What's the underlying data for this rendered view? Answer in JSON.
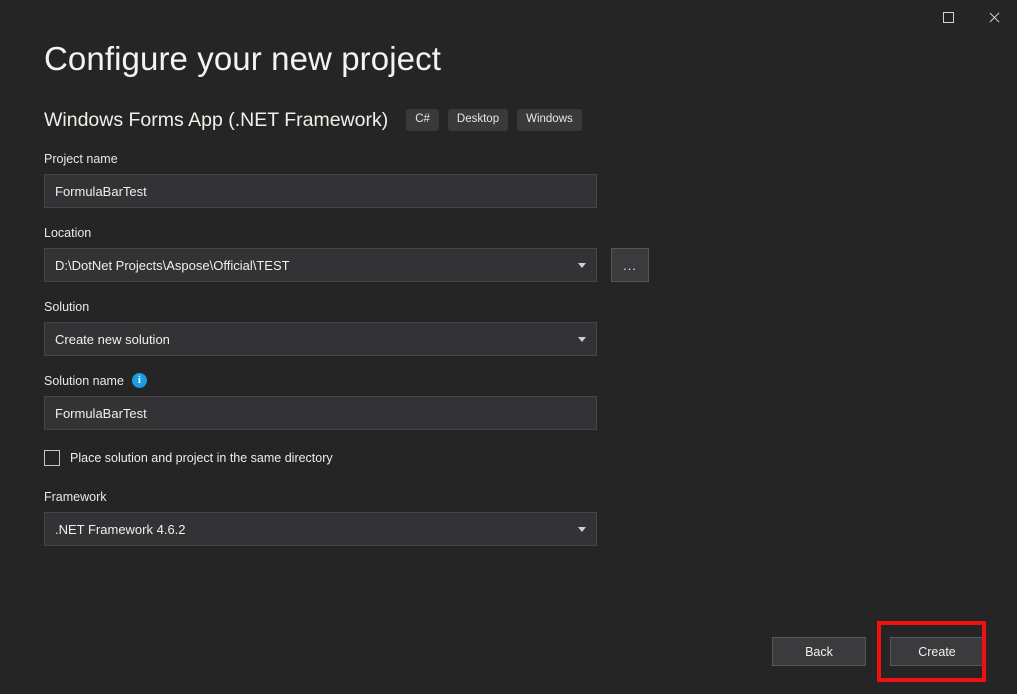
{
  "window": {
    "controls": [
      {
        "name": "maximize-button",
        "icon": "maximize-icon",
        "label": "Maximize"
      },
      {
        "name": "close-button",
        "icon": "close-icon",
        "label": "Close"
      }
    ]
  },
  "header": {
    "title": "Configure your new project",
    "template_name": "Windows Forms App (.NET Framework)",
    "tags": [
      "C#",
      "Desktop",
      "Windows"
    ]
  },
  "form": {
    "project_name": {
      "label": "Project name",
      "value": "FormulaBarTest",
      "placeholder": ""
    },
    "location": {
      "label": "Location",
      "value": "D:\\DotNet Projects\\Aspose\\Official\\TEST",
      "placeholder": "",
      "browse_label": "..."
    },
    "solution": {
      "label": "Solution",
      "value": "Create new solution"
    },
    "solution_name": {
      "label": "Solution name",
      "info_icon_glyph": "i",
      "value": "FormulaBarTest",
      "placeholder": ""
    },
    "same_directory": {
      "label": "Place solution and project in the same directory",
      "checked": false
    },
    "framework": {
      "label": "Framework",
      "value": ".NET Framework 4.6.2"
    }
  },
  "footer": {
    "back_label": "Back",
    "create_label": "Create"
  },
  "colors": {
    "background": "#252526",
    "input_background": "#333336",
    "input_border": "#46464a",
    "tag_background": "#3a3a3c",
    "button_background": "#3b3b3e",
    "info_icon": "#1b9de2",
    "highlight": "#ee1111",
    "text": "#f0f0f0"
  }
}
